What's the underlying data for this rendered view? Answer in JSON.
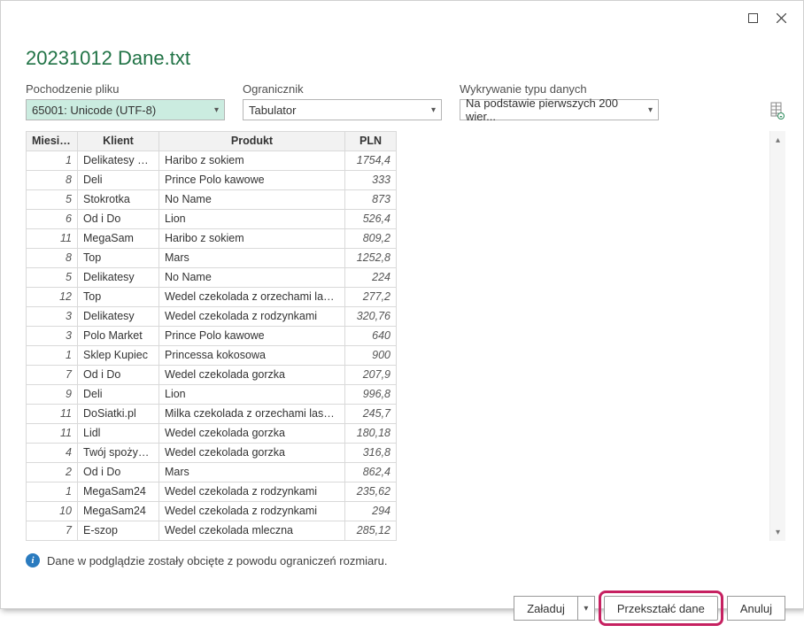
{
  "window": {
    "filename": "20231012 Dane.txt"
  },
  "fields": {
    "origin_label": "Pochodzenie pliku",
    "origin_value": "65001: Unicode (UTF-8)",
    "delimiter_label": "Ogranicznik",
    "delimiter_value": "Tabulator",
    "detect_label": "Wykrywanie typu danych",
    "detect_value": "Na podstawie pierwszych 200 wier..."
  },
  "table": {
    "headers": [
      "Miesiąc",
      "Klient",
      "Produkt",
      "PLN"
    ],
    "rows": [
      [
        "1",
        "Delikatesy Polo",
        "Haribo z sokiem",
        "1754,4"
      ],
      [
        "8",
        "Deli",
        "Prince Polo kawowe",
        "333"
      ],
      [
        "5",
        "Stokrotka",
        "No Name",
        "873"
      ],
      [
        "6",
        "Od i Do",
        "Lion",
        "526,4"
      ],
      [
        "11",
        "MegaSam",
        "Haribo z sokiem",
        "809,2"
      ],
      [
        "8",
        "Top",
        "Mars",
        "1252,8"
      ],
      [
        "5",
        "Delikatesy",
        "No Name",
        "224"
      ],
      [
        "12",
        "Top",
        "Wedel czekolada z orzechami laskowymi",
        "277,2"
      ],
      [
        "3",
        "Delikatesy",
        "Wedel czekolada z rodzynkami",
        "320,76"
      ],
      [
        "3",
        "Polo Market",
        "Prince Polo kawowe",
        "640"
      ],
      [
        "1",
        "Sklep Kupiec",
        "Princessa kokosowa",
        "900"
      ],
      [
        "7",
        "Od i Do",
        "Wedel czekolada gorzka",
        "207,9"
      ],
      [
        "9",
        "Deli",
        "Lion",
        "996,8"
      ],
      [
        "11",
        "DoSiatki.pl",
        "Milka czekolada z orzechami laskowymi",
        "245,7"
      ],
      [
        "11",
        "Lidl",
        "Wedel czekolada gorzka",
        "180,18"
      ],
      [
        "4",
        "Twój spożywczy",
        "Wedel czekolada gorzka",
        "316,8"
      ],
      [
        "2",
        "Od i Do",
        "Mars",
        "862,4"
      ],
      [
        "1",
        "MegaSam24",
        "Wedel czekolada z rodzynkami",
        "235,62"
      ],
      [
        "10",
        "MegaSam24",
        "Wedel czekolada z rodzynkami",
        "294"
      ],
      [
        "7",
        "E-szop",
        "Wedel czekolada mleczna",
        "285,12"
      ]
    ]
  },
  "info": {
    "text": "Dane w podglądzie zostały obcięte z powodu ograniczeń rozmiaru."
  },
  "footer": {
    "load": "Załaduj",
    "transform": "Przekształć dane",
    "cancel": "Anuluj"
  }
}
